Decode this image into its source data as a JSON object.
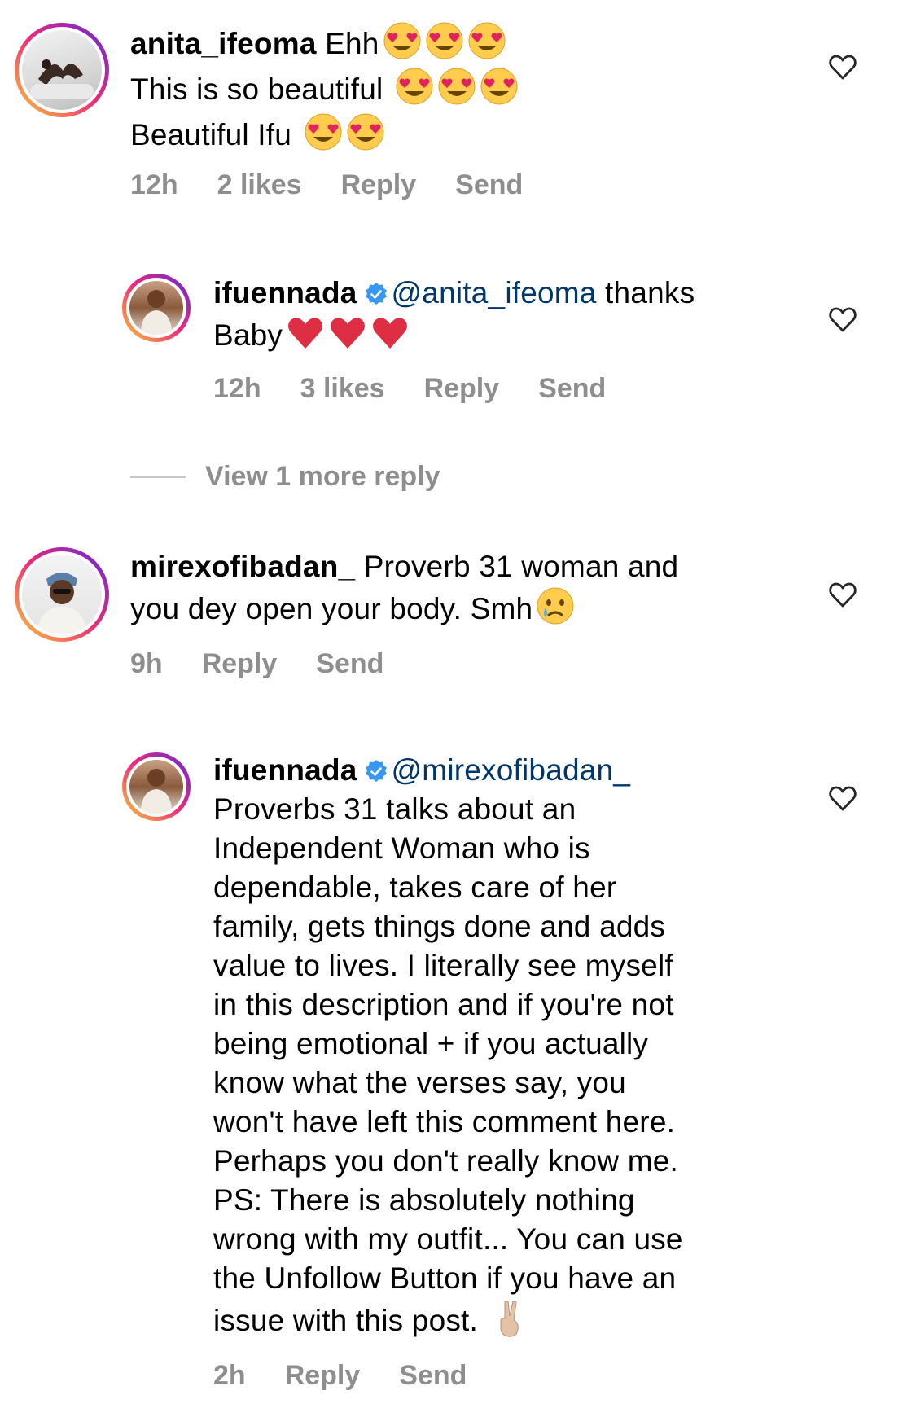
{
  "comments": [
    {
      "username": "anita_ifeoma",
      "lines": [
        "Ehh",
        "This is so beautiful",
        "Beautiful Ifu"
      ],
      "time": "12h",
      "likes": "2 likes",
      "reply": "Reply",
      "send": "Send"
    },
    {
      "username": "ifuennada",
      "mention": "@anita_ifeoma",
      "text_after_mention": " thanks",
      "line2": "Baby",
      "time": "12h",
      "likes": "3 likes",
      "reply": "Reply",
      "send": "Send"
    },
    {
      "username": "mirexofibadan_",
      "text": " Proverb 31 woman and",
      "line2": "you dey open your body. Smh",
      "time": "9h",
      "reply": "Reply",
      "send": "Send"
    },
    {
      "username": "ifuennada",
      "mention": "@mirexofibadan_",
      "body_lines": [
        "Proverbs 31 talks about an",
        "Independent Woman who is",
        "dependable, takes care of her",
        "family, gets things done and adds",
        "value to lives. I literally see myself",
        "in this description and if you're not",
        "being emotional + if you actually",
        "know what the verses say, you",
        "won't have left this comment here.",
        "Perhaps you don't really know me.",
        "PS: There is absolutely nothing",
        "wrong with my outfit... You can use",
        "the Unfollow Button if you have an",
        "issue with this post."
      ],
      "time": "2h",
      "reply": "Reply",
      "send": "Send"
    }
  ],
  "view_more": "View 1 more reply",
  "icons": {
    "heart": "heart-outline-icon",
    "verified": "verified-badge-icon",
    "heart_eyes": "heart-eyes-emoji",
    "red_heart": "red-heart-emoji",
    "crying": "crying-face-emoji",
    "victory": "victory-hand-emoji"
  },
  "colors": {
    "mention": "#00376b",
    "meta": "#8e8e8e",
    "verified": "#3897f0"
  }
}
